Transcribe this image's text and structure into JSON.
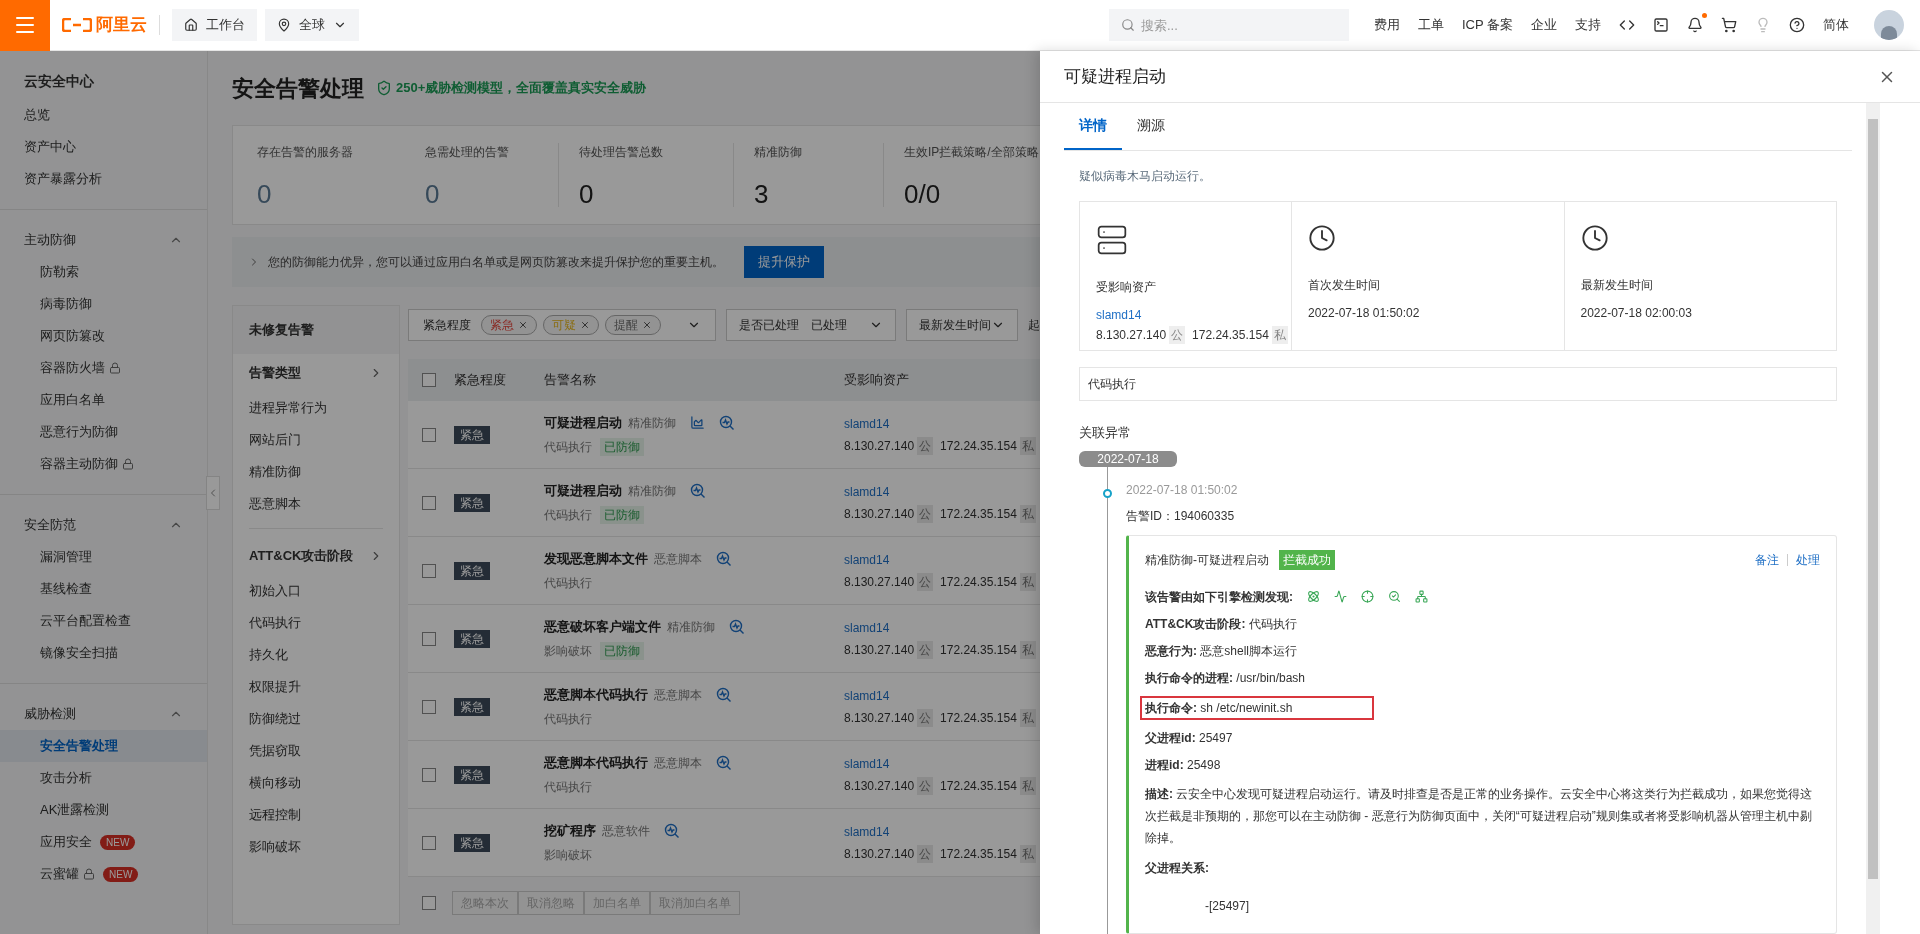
{
  "topbar": {
    "brand": "阿里云",
    "workbench": "工作台",
    "region": "全球",
    "search": {
      "placeholder": "搜索..."
    },
    "links": [
      "费用",
      "工单",
      "ICP 备案",
      "企业",
      "支持"
    ],
    "language": "简体"
  },
  "sidebar": {
    "title": "云安全中心",
    "items": [
      {
        "label": "总览",
        "selected": false
      },
      {
        "label": "资产中心",
        "selected": false
      },
      {
        "label": "资产暴露分析",
        "selected": false
      }
    ],
    "groups": [
      {
        "label": "主动防御",
        "expanded": true,
        "items": [
          {
            "label": "防勒索",
            "selected": false,
            "locked": false
          },
          {
            "label": "病毒防御",
            "selected": false,
            "locked": false
          },
          {
            "label": "网页防篡改",
            "selected": false,
            "locked": false
          },
          {
            "label": "容器防火墙",
            "selected": false,
            "locked": true
          },
          {
            "label": "应用白名单",
            "selected": false,
            "locked": false
          },
          {
            "label": "恶意行为防御",
            "selected": false,
            "locked": false
          },
          {
            "label": "容器主动防御",
            "selected": false,
            "locked": true
          }
        ]
      },
      {
        "label": "安全防范",
        "expanded": true,
        "items": [
          {
            "label": "漏洞管理",
            "selected": false,
            "locked": false
          },
          {
            "label": "基线检查",
            "selected": false,
            "locked": false
          },
          {
            "label": "云平台配置检查",
            "selected": false,
            "locked": false
          },
          {
            "label": "镜像安全扫描",
            "selected": false,
            "locked": false
          }
        ]
      },
      {
        "label": "威胁检测",
        "expanded": true,
        "items": [
          {
            "label": "安全告警处理",
            "selected": true,
            "locked": false
          },
          {
            "label": "攻击分析",
            "selected": false,
            "locked": false
          },
          {
            "label": "AK泄露检测",
            "selected": false,
            "locked": false
          },
          {
            "label": "应用安全",
            "selected": false,
            "locked": false,
            "badge": "NEW"
          },
          {
            "label": "云蜜罐",
            "selected": false,
            "locked": true,
            "badge": "NEW"
          }
        ]
      }
    ]
  },
  "main": {
    "title": "安全告警处理",
    "slogan": "250+威胁检测模型，全面覆盖真实安全威胁",
    "stats": [
      {
        "label": "存在告警的服务器",
        "value": "0",
        "kind": "link"
      },
      {
        "label": "急需处理的告警",
        "value": "0",
        "kind": "link"
      },
      {
        "label": "待处理告警总数",
        "value": "0",
        "kind": "plain"
      },
      {
        "label": "精准防御",
        "value": "3",
        "kind": "plain"
      },
      {
        "label": "生效IP拦截策略/全部策略",
        "value": "0/0",
        "kind": "plain"
      }
    ],
    "notice": {
      "text": "您的防御能力优异，您可以通过应用白名单或是网页防篡改来提升保护您的重要主机。",
      "button": "提升保护"
    },
    "categories": {
      "header": "未修复告警",
      "sections": [
        {
          "title": "告警类型",
          "items": [
            "进程异常行为",
            "网站后门",
            "精准防御",
            "恶意脚本"
          ]
        },
        {
          "title": "ATT&CK攻击阶段",
          "items": [
            "初始入口",
            "代码执行",
            "持久化",
            "权限提升",
            "防御绕过",
            "凭据窃取",
            "横向移动",
            "远程控制",
            "影响破坏"
          ]
        }
      ]
    },
    "filters": {
      "severity": {
        "label": "紧急程度",
        "tags": [
          {
            "label": "紧急",
            "color": "#8a2a24"
          },
          {
            "label": "可疑",
            "color": "#8a6d10"
          },
          {
            "label": "提醒",
            "color": "#444444"
          }
        ]
      },
      "processed": {
        "label": "是否已处理",
        "value": "已处理"
      },
      "sort": "最新发生时间",
      "cut_label": "起"
    },
    "table": {
      "select_all_checked": false,
      "bulk_select_checked": false,
      "columns": [
        "紧急程度",
        "告警名称",
        "受影响资产"
      ],
      "rows": [
        {
          "checked": false,
          "severity": "紧急",
          "name": "可疑进程启动",
          "source": "精准防御",
          "category": "代码执行",
          "status": "已防御",
          "chart": true,
          "asset": "slamd14",
          "public_ip": "8.130.27.140",
          "public_tag": "公",
          "private_ip": "172.24.35.154",
          "private_tag": "私"
        },
        {
          "checked": false,
          "severity": "紧急",
          "name": "可疑进程启动",
          "source": "精准防御",
          "category": "代码执行",
          "status": "已防御",
          "chart": false,
          "asset": "slamd14",
          "public_ip": "8.130.27.140",
          "public_tag": "公",
          "private_ip": "172.24.35.154",
          "private_tag": "私"
        },
        {
          "checked": false,
          "severity": "紧急",
          "name": "发现恶意脚本文件",
          "source": "恶意脚本",
          "category": "代码执行",
          "chart": false,
          "asset": "slamd14",
          "public_ip": "8.130.27.140",
          "public_tag": "公",
          "private_ip": "172.24.35.154",
          "private_tag": "私"
        },
        {
          "checked": false,
          "severity": "紧急",
          "name": "恶意破坏客户端文件",
          "source": "精准防御",
          "category": "影响破坏",
          "status": "已防御",
          "chart": false,
          "asset": "slamd14",
          "public_ip": "8.130.27.140",
          "public_tag": "公",
          "private_ip": "172.24.35.154",
          "private_tag": "私"
        },
        {
          "checked": false,
          "severity": "紧急",
          "name": "恶意脚本代码执行",
          "source": "恶意脚本",
          "category": "代码执行",
          "chart": false,
          "asset": "slamd14",
          "public_ip": "8.130.27.140",
          "public_tag": "公",
          "private_ip": "172.24.35.154",
          "private_tag": "私"
        },
        {
          "checked": false,
          "severity": "紧急",
          "name": "恶意脚本代码执行",
          "source": "恶意脚本",
          "category": "代码执行",
          "chart": false,
          "asset": "slamd14",
          "public_ip": "8.130.27.140",
          "public_tag": "公",
          "private_ip": "172.24.35.154",
          "private_tag": "私"
        },
        {
          "checked": false,
          "severity": "紧急",
          "name": "挖矿程序",
          "source": "恶意软件",
          "category": "影响破坏",
          "chart": false,
          "asset": "slamd14",
          "public_ip": "8.130.27.140",
          "public_tag": "公",
          "private_ip": "172.24.35.154",
          "private_tag": "私"
        }
      ],
      "bulk_actions": [
        "忽略本次",
        "取消忽略",
        "加白名单",
        "取消加白名单"
      ]
    }
  },
  "drawer": {
    "title": "可疑进程启动",
    "tabs": [
      {
        "label": "详情",
        "selected": true
      },
      {
        "label": "溯源",
        "selected": false
      }
    ],
    "summary": "疑似病毒木马启动运行。",
    "asset": {
      "label": "受影响资产",
      "name": "slamd14",
      "public_ip": "8.130.27.140",
      "public_tag": "公",
      "private_ip": "172.24.35.154",
      "private_tag": "私"
    },
    "times": [
      {
        "label": "首次发生时间",
        "value": "2022-07-18 01:50:02"
      },
      {
        "label": "最新发生时间",
        "value": "2022-07-18 02:00:03"
      }
    ],
    "tag": "代码执行",
    "related_title": "关联异常",
    "date": "2022-07-18",
    "event": {
      "time": "2022-07-18 01:50:02",
      "alert_id": "告警ID：194060335",
      "title": "精准防御-可疑进程启动",
      "status": "拦截成功",
      "actions": [
        "备注",
        "处理"
      ],
      "engines_label": "该告警由如下引擎检测发现:",
      "fields": [
        {
          "text": "**ATT&CK攻击阶段:** 代码执行",
          "highlighted": false
        },
        {
          "text": "**恶意行为:** 恶意shell脚本运行",
          "highlighted": false
        },
        {
          "text": "**执行命令的进程:** /usr/bin/bash",
          "highlighted": false
        },
        {
          "text": "**执行命令:** sh /etc/newinit.sh",
          "highlighted": true
        },
        {
          "text": "**父进程id:** 25497",
          "highlighted": false
        },
        {
          "text": "**进程id:** 25498",
          "highlighted": false
        },
        {
          "text": "**描述:** 云安全中心发现可疑进程启动运行。请及时排查是否是正常的业务操作。云安全中心将这类行为拦截成功，如果您觉得这次拦截是非预期的，那您可以在主动防御 - 恶意行为防御页面中，关闭“可疑进程启动”规则集或者将受影响机器从管理主机中剔除掉。",
          "highlighted": false
        }
      ],
      "tree_label": "父进程关系:",
      "tree": "-[25497]"
    }
  }
}
